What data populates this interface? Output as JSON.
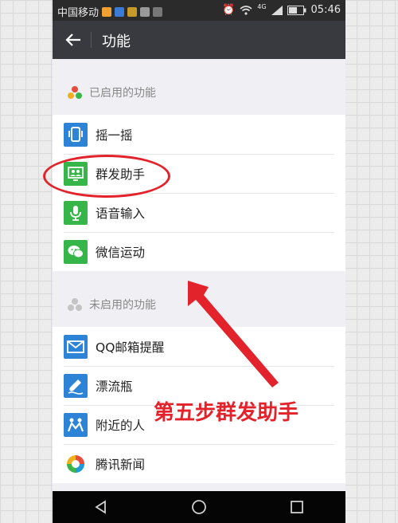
{
  "status_bar": {
    "carrier": "中国移动",
    "network": "4G",
    "time": "05:46"
  },
  "header": {
    "title": "功能"
  },
  "enabled_section": {
    "label": "已启用的功能",
    "items": [
      {
        "label": "摇一摇",
        "icon": "phone-shake-icon",
        "color": "#2d83d6"
      },
      {
        "label": "群发助手",
        "icon": "broadcast-icon",
        "color": "#36b548"
      },
      {
        "label": "语音输入",
        "icon": "microphone-icon",
        "color": "#36b548"
      },
      {
        "label": "微信运动",
        "icon": "wechat-sport-icon",
        "color": "#36b548"
      }
    ]
  },
  "disabled_section": {
    "label": "未启用的功能",
    "items": [
      {
        "label": "QQ邮箱提醒",
        "icon": "mail-icon",
        "color": "#2d83d6"
      },
      {
        "label": "漂流瓶",
        "icon": "drift-bottle-icon",
        "color": "#2d83d6"
      },
      {
        "label": "附近的人",
        "icon": "people-nearby-icon",
        "color": "#2d83d6"
      },
      {
        "label": "腾讯新闻",
        "icon": "tencent-news-icon",
        "color": "#1e9bd7"
      }
    ]
  },
  "annotation": {
    "text": "第五步群发助手",
    "color": "#e3232b"
  },
  "colors": {
    "title_bar": "#393a3f",
    "status_bar": "#2b2b2b",
    "nav_bar": "#050505",
    "background": "#efeff4"
  }
}
